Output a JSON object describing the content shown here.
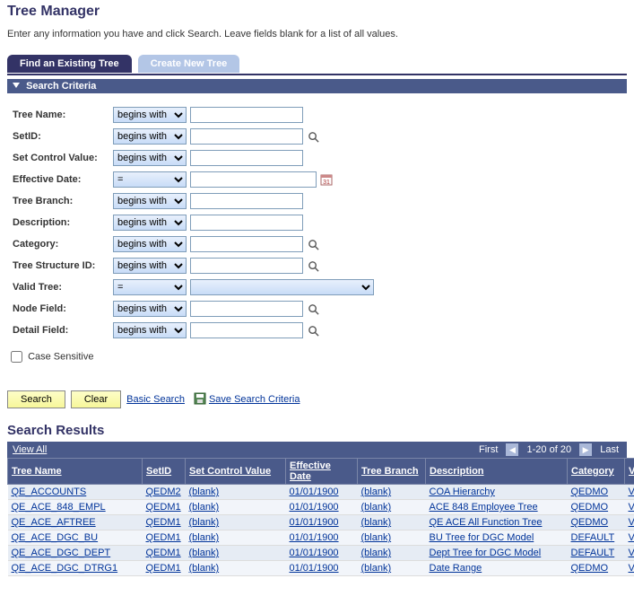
{
  "page_title": "Tree Manager",
  "instructions": "Enter any information you have and click Search. Leave fields blank for a list of all values.",
  "tabs": {
    "find": "Find an Existing Tree",
    "create": "Create New Tree"
  },
  "section_header": "Search Criteria",
  "criteria": [
    {
      "label": "Tree Name:",
      "op": "begins with",
      "type": "text",
      "lookup": false
    },
    {
      "label": "SetID:",
      "op": "begins with",
      "type": "text",
      "lookup": true
    },
    {
      "label": "Set Control Value:",
      "op": "begins with",
      "type": "text",
      "lookup": false
    },
    {
      "label": "Effective Date:",
      "op": "=",
      "type": "date",
      "lookup": false
    },
    {
      "label": "Tree Branch:",
      "op": "begins with",
      "type": "text",
      "lookup": false
    },
    {
      "label": "Description:",
      "op": "begins with",
      "type": "text",
      "lookup": false
    },
    {
      "label": "Category:",
      "op": "begins with",
      "type": "text",
      "lookup": true
    },
    {
      "label": "Tree Structure ID:",
      "op": "begins with",
      "type": "text",
      "lookup": true
    },
    {
      "label": "Valid Tree:",
      "op": "=",
      "type": "select",
      "lookup": false
    },
    {
      "label": "Node Field:",
      "op": "begins with",
      "type": "text",
      "lookup": true
    },
    {
      "label": "Detail Field:",
      "op": "begins with",
      "type": "text",
      "lookup": true
    }
  ],
  "case_sensitive_label": "Case Sensitive",
  "buttons": {
    "search": "Search",
    "clear": "Clear",
    "basic_search": "Basic Search",
    "save_criteria": "Save Search Criteria"
  },
  "results_title": "Search Results",
  "nav": {
    "view_all": "View All",
    "first": "First",
    "range": "1-20 of 20",
    "last": "Last"
  },
  "columns": [
    "Tree Name",
    "SetID",
    "Set Control Value",
    "Effective Date",
    "Tree Branch",
    "Description",
    "Category",
    "Valid Tree"
  ],
  "rows": [
    {
      "tree": "QE_ACCOUNTS",
      "setid": "QEDM2",
      "scv": "(blank)",
      "eff": "01/01/1900",
      "branch": "(blank)",
      "desc": "COA Hierarchy",
      "cat": "QEDMO",
      "valid": "Valid Tree"
    },
    {
      "tree": "QE_ACE_848_EMPL",
      "setid": "QEDM1",
      "scv": "(blank)",
      "eff": "01/01/1900",
      "branch": "(blank)",
      "desc": "ACE 848 Employee Tree",
      "cat": "QEDMO",
      "valid": "Valid Tree"
    },
    {
      "tree": "QE_ACE_AFTREE",
      "setid": "QEDM1",
      "scv": "(blank)",
      "eff": "01/01/1900",
      "branch": "(blank)",
      "desc": "QE ACE All Function Tree",
      "cat": "QEDMO",
      "valid": "Valid Tree"
    },
    {
      "tree": "QE_ACE_DGC_BU",
      "setid": "QEDM1",
      "scv": "(blank)",
      "eff": "01/01/1900",
      "branch": "(blank)",
      "desc": "BU Tree for DGC Model",
      "cat": "DEFAULT",
      "valid": "Valid Tree"
    },
    {
      "tree": "QE_ACE_DGC_DEPT",
      "setid": "QEDM1",
      "scv": "(blank)",
      "eff": "01/01/1900",
      "branch": "(blank)",
      "desc": "Dept Tree for DGC Model",
      "cat": "DEFAULT",
      "valid": "Valid Tree"
    },
    {
      "tree": "QE_ACE_DGC_DTRG1",
      "setid": "QEDM1",
      "scv": "(blank)",
      "eff": "01/01/1900",
      "branch": "(blank)",
      "desc": "Date Range",
      "cat": "QEDMO",
      "valid": "Valid Tree"
    }
  ]
}
